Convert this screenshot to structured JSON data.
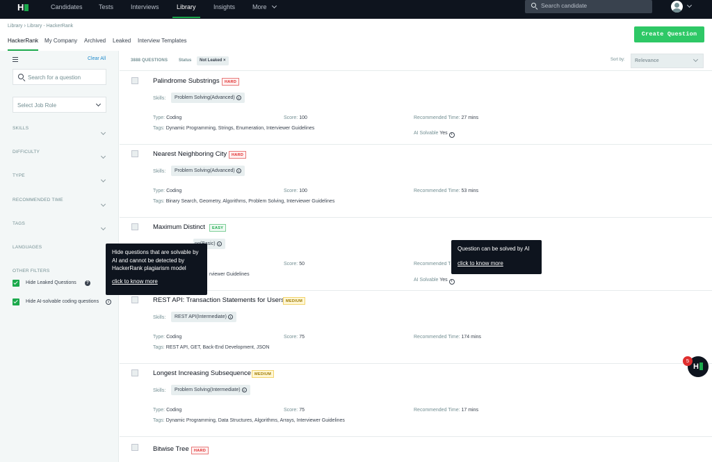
{
  "nav": {
    "logo": "H",
    "items": [
      "Candidates",
      "Tests",
      "Interviews",
      "Library",
      "Insights",
      "More"
    ],
    "active": "Library",
    "search_placeholder": "Search candidate"
  },
  "breadcrumb": [
    "Library",
    "Library - HackerRank"
  ],
  "subtabs": [
    "HackerRank",
    "My Company",
    "Archived",
    "Leaked",
    "Interview Templates"
  ],
  "create_button": "Create Question",
  "sidebar": {
    "clear_all": "Clear All",
    "search_placeholder": "Search for a question",
    "job_role_placeholder": "Select Job Role",
    "filters": [
      "SKILLS",
      "DIFFICULTY",
      "TYPE",
      "RECOMMENDED TIME",
      "TAGS",
      "LANGUAGES"
    ],
    "other_filters_label": "OTHER FILTERS",
    "checkboxes": [
      {
        "label": "Hide Leaked Questions",
        "checked": true
      },
      {
        "label": "Hide AI-solvable coding questions",
        "checked": true
      }
    ]
  },
  "list_header": {
    "count": "3888 QUESTIONS",
    "status_label": "Status",
    "status_value": "Not Leaked",
    "sort_label": "Sort by:",
    "sort_value": "Relevance"
  },
  "labels": {
    "skills": "Skills:",
    "type": "Type:",
    "score": "Score:",
    "recommended_time": "Recommended Time:",
    "tags": "Tags:",
    "ai_solvable": "AI Solvable"
  },
  "questions": [
    {
      "title": "Palindrome Substrings",
      "difficulty": "HARD",
      "skill": "Problem Solving(Advanced)",
      "type": "Coding",
      "score": "100",
      "time": "27 mins",
      "tags": "Dynamic Programming, Strings, Enumeration, Interviewer Guidelines",
      "ai_solvable": "Yes"
    },
    {
      "title": "Nearest Neighboring City",
      "difficulty": "HARD",
      "skill": "Problem Solving(Advanced)",
      "type": "Coding",
      "score": "100",
      "time": "53 mins",
      "tags": "Binary Search, Geometry, Algorithms, Problem Solving, Interviewer Guidelines",
      "ai_solvable": ""
    },
    {
      "title": "Maximum Distinct",
      "difficulty": "EASY",
      "skill": "ng(Basic)",
      "type": "",
      "score": "50",
      "time": "",
      "tags": "rviewer Guidelines",
      "ai_solvable": "Yes"
    },
    {
      "title": "REST API: Transaction Statements for Users",
      "difficulty": "MEDIUM",
      "skill": "REST API(Intermediate)",
      "type": "Coding",
      "score": "75",
      "time": "174 mins",
      "tags": "REST API, GET, Back-End Development, JSON",
      "ai_solvable": ""
    },
    {
      "title": "Longest Increasing Subsequence",
      "difficulty": "MEDIUM",
      "skill": "Problem Solving(Intermediate)",
      "type": "Coding",
      "score": "75",
      "time": "17 mins",
      "tags": "Dynamic Programming, Data Structures, Algorithms, Arrays, Interviewer Guidelines",
      "ai_solvable": ""
    },
    {
      "title": "Bitwise Tree",
      "difficulty": "HARD"
    }
  ],
  "tooltips": {
    "hide_ai": {
      "text": "Hide questions that are solvable by AI and cannot be detected by HackerRank plagiarism model",
      "link": "click to know more"
    },
    "ai_solvable": {
      "text": "Question can be solved by AI",
      "link": "click to know more"
    }
  },
  "chat_badge": "5",
  "colors": {
    "nav_bg": "#0e141e",
    "accent": "#1ba94c",
    "button": "#2ec866",
    "hard": "#e02e2e",
    "medium": "#f2d36a"
  }
}
